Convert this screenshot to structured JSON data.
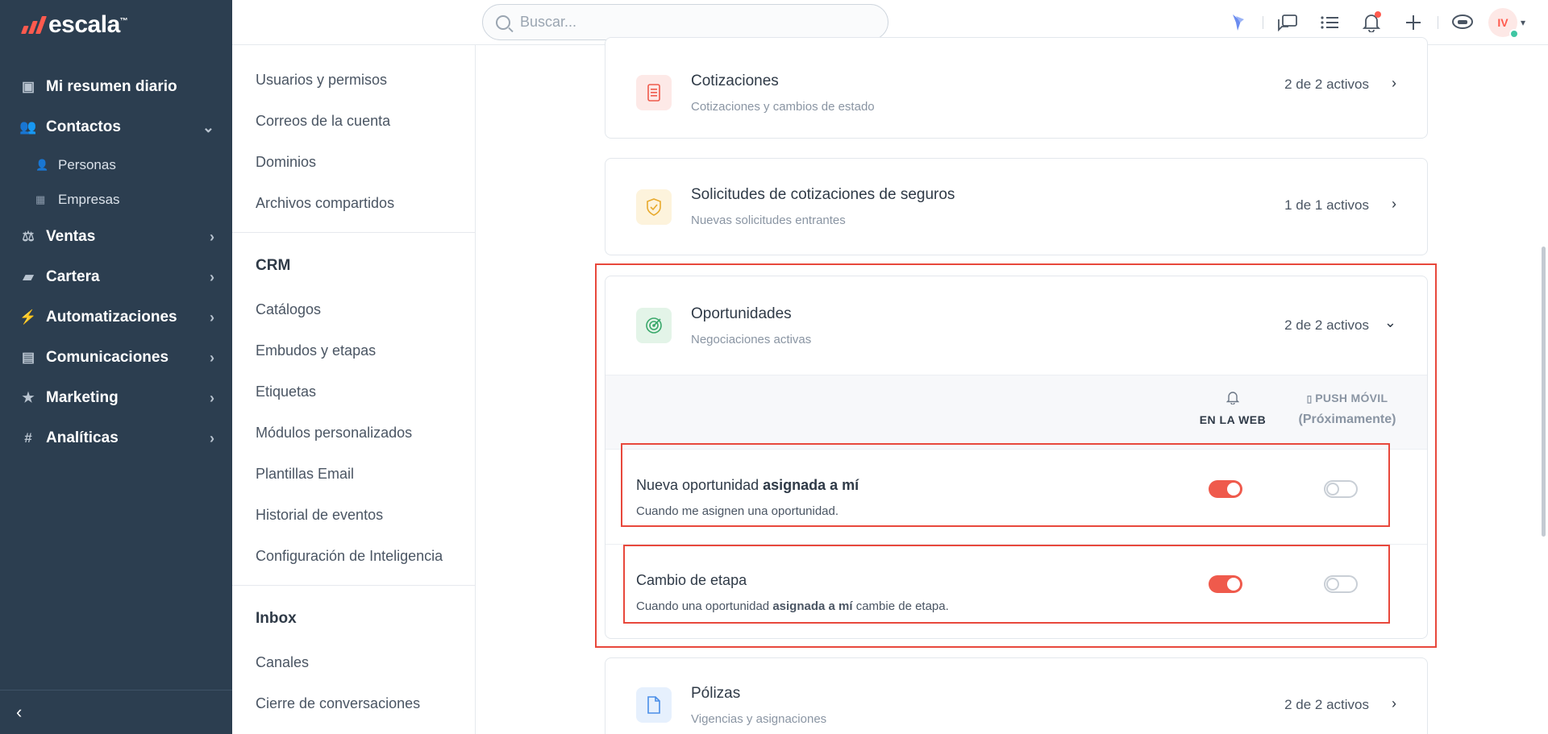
{
  "brand": {
    "name": "escala",
    "tm": "™"
  },
  "sidebar": {
    "items": [
      {
        "label": "Mi resumen diario",
        "icon": "chart-icon",
        "glyph": "▣"
      },
      {
        "label": "Contactos",
        "icon": "contacts-icon",
        "glyph": "👥",
        "expanded": true,
        "children": [
          {
            "label": "Personas",
            "glyph": "👤"
          },
          {
            "label": "Empresas",
            "glyph": "▦"
          }
        ]
      },
      {
        "label": "Ventas",
        "icon": "sales-icon",
        "glyph": "⚖"
      },
      {
        "label": "Cartera",
        "icon": "wallet-icon",
        "glyph": "▰"
      },
      {
        "label": "Automatizaciones",
        "icon": "bolt-icon",
        "glyph": "⚡"
      },
      {
        "label": "Comunicaciones",
        "icon": "chat-icon",
        "glyph": "▤"
      },
      {
        "label": "Marketing",
        "icon": "star-icon",
        "glyph": "★"
      },
      {
        "label": "Analíticas",
        "icon": "hash-icon",
        "glyph": "#"
      }
    ],
    "collapse_glyph": "‹"
  },
  "search": {
    "placeholder": "Buscar..."
  },
  "settings_nav": {
    "general": [
      "Usuarios y permisos",
      "Correos de la cuenta",
      "Dominios",
      "Archivos compartidos"
    ],
    "crm_title": "CRM",
    "crm": [
      "Catálogos",
      "Embudos y etapas",
      "Etiquetas",
      "Módulos personalizados",
      "Plantillas Email",
      "Historial de eventos",
      "Configuración de Inteligencia"
    ],
    "inbox_title": "Inbox",
    "inbox": [
      "Canales",
      "Cierre de conversaciones"
    ]
  },
  "cards": {
    "cotizaciones": {
      "title": "Cotizaciones",
      "sub": "Cotizaciones y cambios de estado",
      "count": "2 de 2 activos"
    },
    "solicitudes": {
      "title": "Solicitudes de cotizaciones de seguros",
      "sub": "Nuevas solicitudes entrantes",
      "count": "1 de 1 activos"
    },
    "oportunidades": {
      "title": "Oportunidades",
      "sub": "Negociaciones activas",
      "count": "2 de 2 activos"
    },
    "polizas": {
      "title": "Pólizas",
      "sub": "Vigencias y asignaciones",
      "count": "2 de 2 activos"
    }
  },
  "table": {
    "col_web": "EN LA WEB",
    "col_push": "PUSH MÓVIL",
    "col_push_note": "(Próximamente)"
  },
  "rows": [
    {
      "title_pre": "Nueva oportunidad ",
      "title_bold": "asignada a mí",
      "sub_pre": "Cuando me asignen una oportunidad.",
      "sub_bold": "",
      "sub_post": "",
      "web_on": true,
      "push_on": false
    },
    {
      "title_pre": "Cambio de etapa",
      "title_bold": "",
      "sub_pre": "Cuando una oportunidad ",
      "sub_bold": "asignada a mí",
      "sub_post": " cambie de etapa.",
      "web_on": true,
      "push_on": false
    }
  ],
  "user": {
    "initials": "IV"
  },
  "colors": {
    "accent": "#ef5a4c",
    "sidebar": "#2c3e50",
    "highlight": "#e8483c"
  }
}
